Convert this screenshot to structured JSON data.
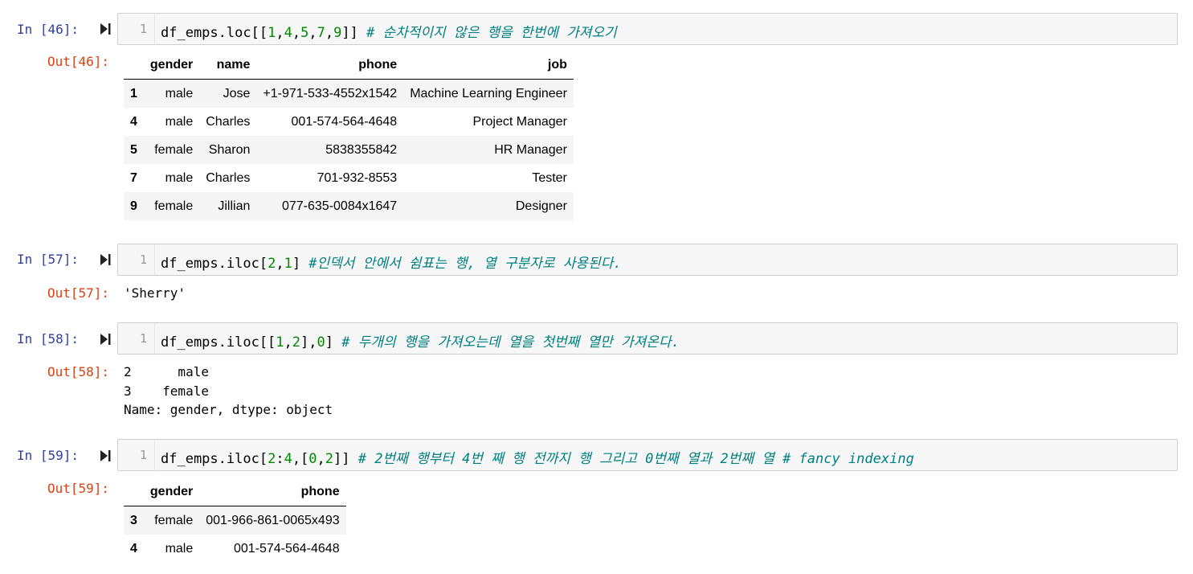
{
  "cells": [
    {
      "in_prompt": "In [46]:",
      "out_prompt": "Out[46]:",
      "line_number": "1",
      "code_parts": [
        "df_emps.loc[[",
        "1",
        ",",
        "4",
        ",",
        "5",
        ",",
        "7",
        ",",
        "9",
        "]] ",
        "# 순차적이지 않은 행을 한번에 가져오기"
      ],
      "table": {
        "columns": [
          "gender",
          "name",
          "phone",
          "job"
        ],
        "rows": [
          {
            "index": "1",
            "cells": [
              "male",
              "Jose",
              "+1-971-533-4552x1542",
              "Machine Learning Engineer"
            ]
          },
          {
            "index": "4",
            "cells": [
              "male",
              "Charles",
              "001-574-564-4648",
              "Project Manager"
            ]
          },
          {
            "index": "5",
            "cells": [
              "female",
              "Sharon",
              "5838355842",
              "HR Manager"
            ]
          },
          {
            "index": "7",
            "cells": [
              "male",
              "Charles",
              "701-932-8553",
              "Tester"
            ]
          },
          {
            "index": "9",
            "cells": [
              "female",
              "Jillian",
              "077-635-0084x1647",
              "Designer"
            ]
          }
        ]
      }
    },
    {
      "in_prompt": "In [57]:",
      "out_prompt": "Out[57]:",
      "line_number": "1",
      "code_parts": [
        "df_emps.iloc[",
        "2",
        ",",
        "1",
        "] ",
        "#인덱서 안에서 쉼표는 행, 열 구분자로 사용된다."
      ],
      "output_text": "'Sherry'"
    },
    {
      "in_prompt": "In [58]:",
      "out_prompt": "Out[58]:",
      "line_number": "1",
      "code_parts": [
        "df_emps.iloc[[",
        "1",
        ",",
        "2",
        "],",
        "0",
        "] ",
        "# 두개의 행을 가져오는데 열을 첫번째 열만 가져온다."
      ],
      "output_lines": [
        "2      male",
        "3    female",
        "Name: gender, dtype: object"
      ]
    },
    {
      "in_prompt": "In [59]:",
      "out_prompt": "Out[59]:",
      "line_number": "1",
      "code_parts": [
        "df_emps.iloc[",
        "2",
        ":",
        "4",
        ",[",
        "0",
        ",",
        "2",
        "]] ",
        "# 2번째 행부터 4번 째 행 전까지 행 그리고 0번째 열과 2번째 열 # fancy indexing"
      ],
      "table": {
        "columns": [
          "gender",
          "phone"
        ],
        "rows": [
          {
            "index": "3",
            "cells": [
              "female",
              "001-966-861-0065x493"
            ]
          },
          {
            "index": "4",
            "cells": [
              "male",
              "001-574-564-4648"
            ]
          }
        ]
      }
    }
  ],
  "colors": {
    "in_prompt": "#303f9f",
    "out_prompt": "#d84315",
    "number": "#008800",
    "comment": "#008080"
  },
  "icons": {
    "run": "run-cell-icon"
  }
}
